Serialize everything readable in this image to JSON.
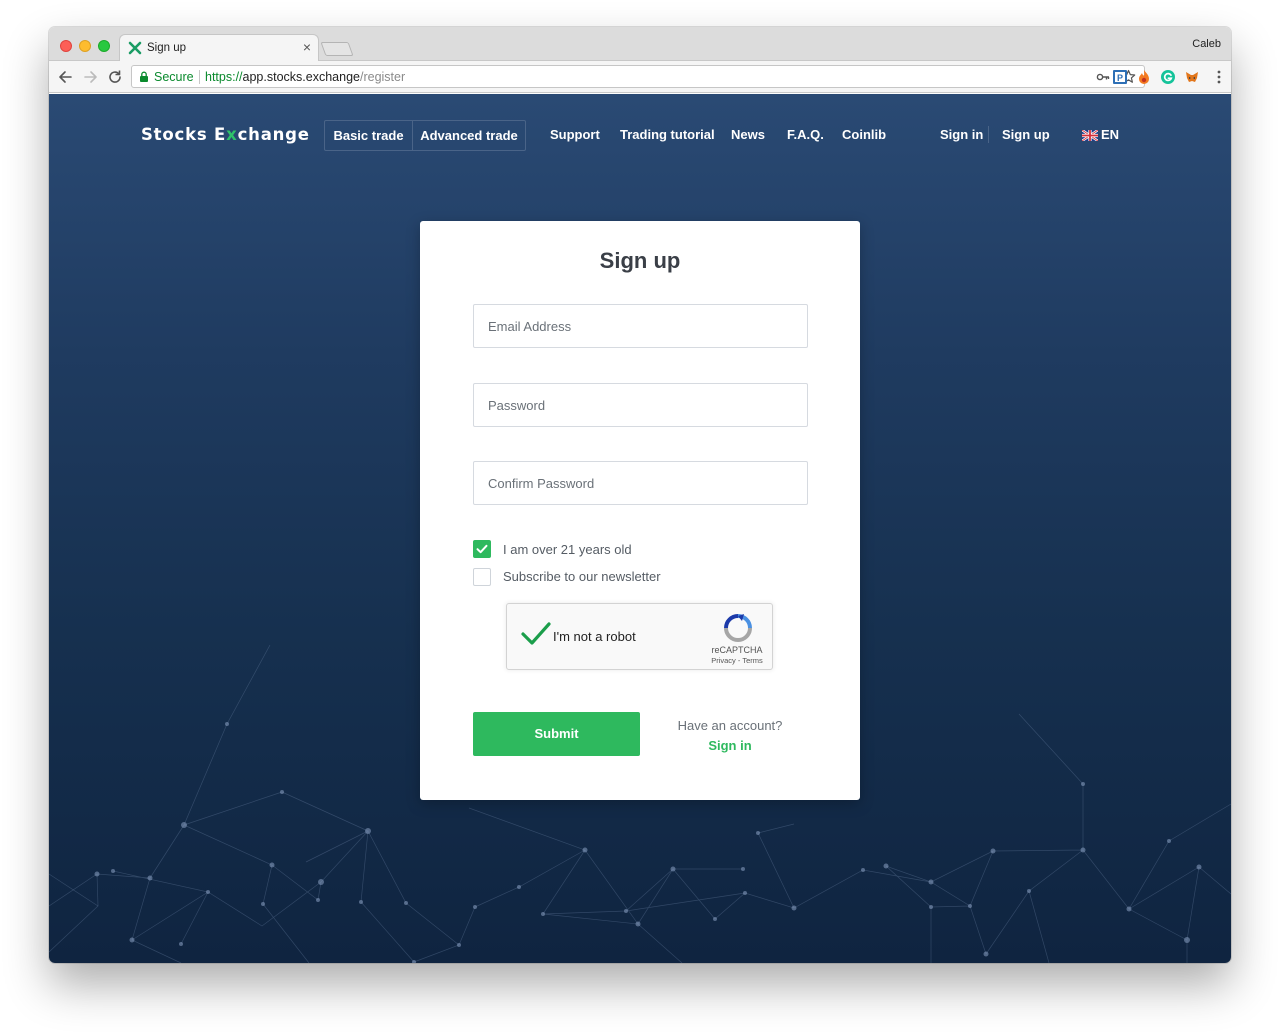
{
  "browser": {
    "tab_title": "Sign up",
    "tab_close": "×",
    "profile_name": "Caleb",
    "secure_label": "Secure",
    "url_scheme": "https://",
    "url_host": "app.stocks.exchange",
    "url_path": "/register"
  },
  "nav": {
    "logo_prefix": "Stocks E",
    "logo_x": "x",
    "logo_suffix": "change",
    "basic_trade": "Basic trade",
    "advanced_trade": "Advanced trade",
    "support": "Support",
    "trading_tutorial": "Trading tutorial",
    "news": "News",
    "faq": "F.A.Q.",
    "coinlib": "Coinlib",
    "sign_in": "Sign in",
    "sign_up": "Sign up",
    "language": "EN"
  },
  "form": {
    "title": "Sign up",
    "email_placeholder": "Email Address",
    "password_placeholder": "Password",
    "confirm_placeholder": "Confirm Password",
    "age_checkbox_label": "I am over 21 years old",
    "age_checked": true,
    "newsletter_checkbox_label": "Subscribe to our newsletter",
    "newsletter_checked": false,
    "captcha_label": "I'm not a robot",
    "captcha_brand": "reCAPTCHA",
    "captcha_links": "Privacy - Terms",
    "submit_label": "Submit",
    "have_account_text": "Have an account?",
    "sign_in_link": "Sign in"
  },
  "colors": {
    "accent_green": "#2eb95e",
    "page_gradient_top": "#2a4a74",
    "page_gradient_bottom": "#0f2440",
    "card_background": "#ffffff"
  },
  "icons": {
    "tab_favicon": "stocks-exchange-x-icon",
    "back": "arrow-left-icon",
    "forward": "arrow-right-icon",
    "reload": "reload-icon",
    "lock": "lock-icon",
    "key": "key-icon",
    "bookmark": "star-icon",
    "language_flag": "uk-flag-icon",
    "checkbox_checked": "checkmark-icon",
    "captcha_logo": "recaptcha-logo-icon"
  }
}
